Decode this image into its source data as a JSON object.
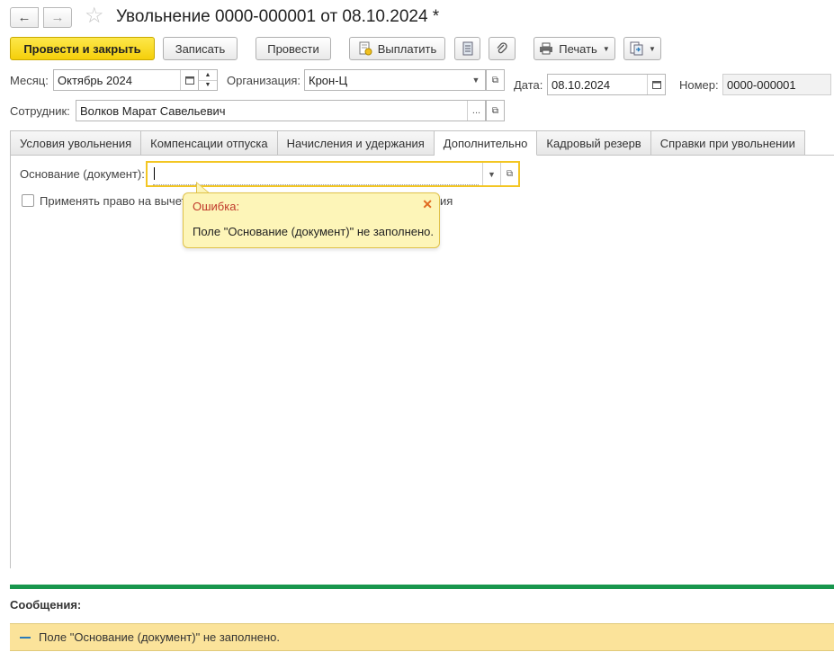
{
  "header": {
    "title": "Увольнение 0000-000001 от 08.10.2024 *",
    "back_glyph": "←",
    "forward_glyph": "→",
    "star_glyph": "☆"
  },
  "toolbar": {
    "post_and_close": "Провести и закрыть",
    "save": "Записать",
    "post": "Провести",
    "pay": "Выплатить",
    "print": "Печать"
  },
  "fields": {
    "month_label": "Месяц:",
    "month_value": "Октябрь 2024",
    "org_label": "Организация:",
    "org_value": "Крон-Ц",
    "date_label": "Дата:",
    "date_value": "08.10.2024",
    "number_label": "Номер:",
    "number_value": "0000-000001",
    "employee_label": "Сотрудник:",
    "employee_value": "Волков Марат Савельевич"
  },
  "tabs": [
    {
      "label": "Условия увольнения"
    },
    {
      "label": "Компенсации отпуска"
    },
    {
      "label": "Начисления и удержания"
    },
    {
      "label": "Дополнительно"
    },
    {
      "label": "Кадровый резерв"
    },
    {
      "label": "Справки при увольнении"
    }
  ],
  "active_tab": "Дополнительно",
  "panel": {
    "basis_label": "Основание (документ):",
    "basis_value": "",
    "checkbox_label_left": "Применять право на вычет",
    "checkbox_label_right": "ия",
    "checkbox_checked": false
  },
  "error_popup": {
    "title": "Ошибка:",
    "message": "Поле \"Основание (документ)\" не заполнено.",
    "close_glyph": "✕"
  },
  "messages": {
    "title": "Сообщения:",
    "items": [
      {
        "text": "Поле \"Основание (документ)\" не заполнено."
      }
    ]
  },
  "colors": {
    "primary_button": "#f5cf0a",
    "error_border": "#f3c623",
    "messages_bar": "#18964d",
    "message_bg": "#fbe39a"
  }
}
